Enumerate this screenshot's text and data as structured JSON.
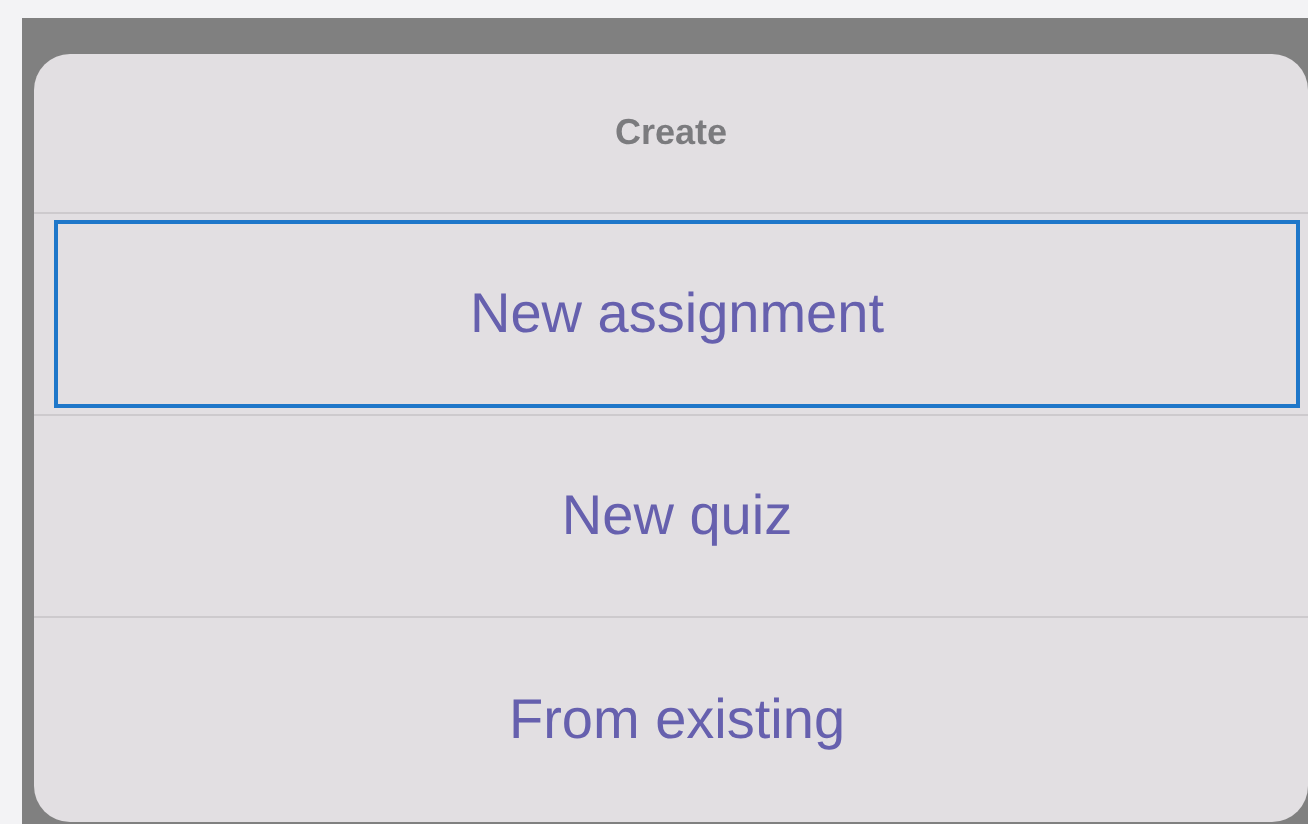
{
  "sheet": {
    "title": "Create"
  },
  "options": [
    {
      "label": "New assignment",
      "selected": true
    },
    {
      "label": "New quiz",
      "selected": false
    },
    {
      "label": "From existing",
      "selected": false
    }
  ]
}
